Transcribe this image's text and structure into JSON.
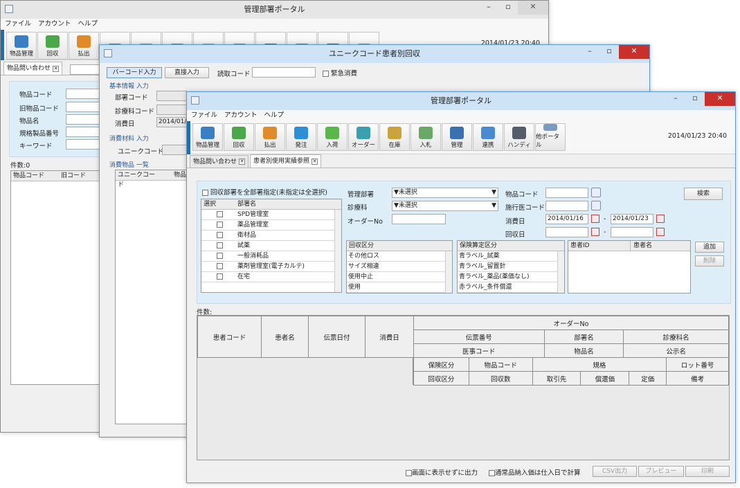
{
  "back_window": {
    "title": "管理部署ポータル",
    "menu": [
      "ファイル",
      "アカウント",
      "ヘルプ"
    ],
    "tools": [
      "物品管理",
      "回収",
      "払出"
    ],
    "datetime": "2014/01/23 20:40",
    "tab_label": "物品問い合わせ",
    "fields": [
      "物品コード",
      "旧物品コード",
      "物品名",
      "規格製品番号",
      "キーワード"
    ],
    "count": "件数:0",
    "columns": [
      "物品コード",
      "旧コード"
    ]
  },
  "mid_window": {
    "title": "ユニークコード患者別回収",
    "mode_barcode": "バーコード入力",
    "mode_direct": "直接入力",
    "read_code_label": "読取コード",
    "urgent_label": "緊急消費",
    "basic_section": "基本情報 入力",
    "dept_label": "部署コード",
    "clinic_label": "診療科コード",
    "date_label": "消費日",
    "date_value": "2014/01/",
    "material_section": "消費材料 入力",
    "unique_label": "ユニークコード",
    "list_section": "消費物品 一覧",
    "list_columns": [
      "ユニークコード",
      "物品"
    ]
  },
  "front_window": {
    "title": "管理部署ポータル",
    "menu": [
      "ファイル",
      "アカウント",
      "ヘルプ"
    ],
    "tools": [
      {
        "label": "物品管理",
        "color": "#3a7fc4"
      },
      {
        "label": "回収",
        "color": "#4aa84a"
      },
      {
        "label": "払出",
        "color": "#e08a2a"
      },
      {
        "label": "発注",
        "color": "#2d8fd6"
      },
      {
        "label": "入荷",
        "color": "#5ab84a"
      },
      {
        "label": "オーダー",
        "color": "#3aa0b0"
      },
      {
        "label": "在庫",
        "color": "#c9a43a"
      },
      {
        "label": "入札",
        "color": "#6aa86a"
      },
      {
        "label": "管理",
        "color": "#3a6fb0"
      },
      {
        "label": "連携",
        "color": "#4a8ad0"
      },
      {
        "label": "ハンディ",
        "color": "#555d6a"
      },
      {
        "label": "他ポータル",
        "color": "#7a9ac0"
      }
    ],
    "datetime": "2014/01/23 20:40",
    "tabs": [
      "物品問い合わせ",
      "患者別使用実績参照"
    ],
    "all_dept_label": "回収部署を全部署指定(未指定は全選択)",
    "dept_list": {
      "headers": [
        "選択",
        "部署名"
      ],
      "rows": [
        "SPD管理室",
        "薬品管理室",
        "衛材品",
        "試薬",
        "一般消耗品",
        "薬剤管理室(電子カルテ)",
        "在宅"
      ]
    },
    "mgmt_dept_label": "管理部署",
    "mgmt_dept_value": "▼未選択",
    "clinic_label": "診療科",
    "clinic_value": "▼未選択",
    "order_label": "オーダーNo",
    "item_code_label": "物品コード",
    "doctor_code_label": "施行医コード",
    "consume_date_label": "消費日",
    "consume_from": "2014/01/16",
    "consume_to": "2014/01/23",
    "collect_date_label": "回収日",
    "range_sep": "-",
    "search_label": "検索",
    "collect_type": {
      "header": "回収区分",
      "rows": [
        "その他ロス",
        "サイズ相違",
        "使用中止",
        "使用"
      ]
    },
    "insurance_type": {
      "header": "保険算定区分",
      "rows": [
        "青ラベル_試薬",
        "青ラベル_留置針",
        "青ラベル_薬品(薬価なし)",
        "赤ラベル_条件償還"
      ]
    },
    "patient_table": {
      "headers": [
        "患者ID",
        "患者名"
      ]
    },
    "add_label": "追加",
    "delete_label": "削除",
    "count_label": "件数:",
    "result_table": {
      "col_patient_code": "患者コード",
      "col_patient_name": "患者名",
      "col_slip_date": "伝票日付",
      "col_consume_date": "消費日",
      "order_no": "オーダーNo",
      "r1": [
        "伝票番号",
        "部署名",
        "診療科名"
      ],
      "r2": [
        "医事コード",
        "物品名",
        "公示名"
      ],
      "r3": [
        "保険区分",
        "物品コード",
        "規格",
        "ロット番号"
      ],
      "r4": [
        "回収区分",
        "回収数",
        "取引先",
        "償還価",
        "定価",
        "備考"
      ]
    },
    "footer": {
      "no_display_label": "画面に表示せずに出力",
      "normal_price_label": "通常品納入価は仕入日で計算",
      "csv_label": "CSV出力",
      "preview_label": "プレビュー",
      "print_label": "印刷"
    }
  }
}
